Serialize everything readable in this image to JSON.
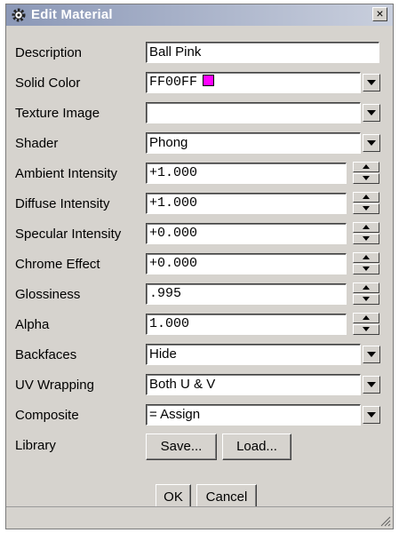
{
  "window": {
    "title": "Edit Material",
    "close_label": "×"
  },
  "fields": {
    "description": {
      "label": "Description",
      "value": "Ball Pink"
    },
    "solid_color": {
      "label": "Solid Color",
      "value": "FF00FF",
      "swatch_color": "#ff00ff"
    },
    "texture_image": {
      "label": "Texture Image",
      "value": ""
    },
    "shader": {
      "label": "Shader",
      "value": "Phong"
    },
    "ambient_intensity": {
      "label": "Ambient Intensity",
      "value": "+1.000"
    },
    "diffuse_intensity": {
      "label": "Diffuse Intensity",
      "value": "+1.000"
    },
    "specular_intensity": {
      "label": "Specular Intensity",
      "value": "+0.000"
    },
    "chrome_effect": {
      "label": "Chrome Effect",
      "value": "+0.000"
    },
    "glossiness": {
      "label": "Glossiness",
      "value": ".995"
    },
    "alpha": {
      "label": "Alpha",
      "value": "1.000"
    },
    "backfaces": {
      "label": "Backfaces",
      "value": "Hide"
    },
    "uv_wrapping": {
      "label": "UV Wrapping",
      "value": "Both U & V"
    },
    "composite": {
      "label": "Composite",
      "value": "= Assign"
    }
  },
  "library": {
    "label": "Library",
    "save_label": "Save...",
    "load_label": "Load..."
  },
  "buttons": {
    "ok_label": "OK",
    "cancel_label": "Cancel"
  },
  "colors": {
    "dialog_bg": "#d6d3ce",
    "title_gradient_start": "#8b98b7",
    "swatch": "#ff00ff"
  }
}
